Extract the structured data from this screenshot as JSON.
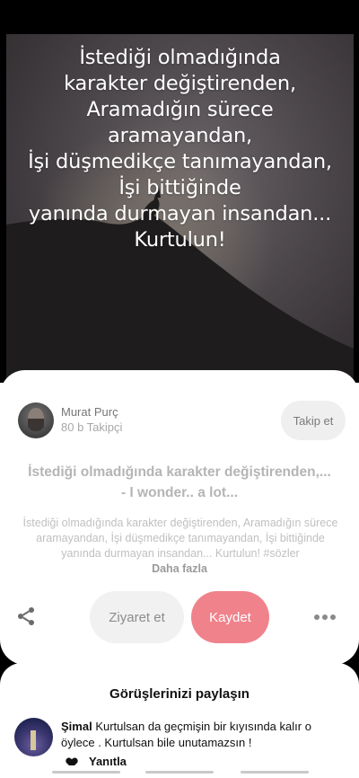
{
  "pin": {
    "quote_text": "İstediği olmadığında\nkarakter değiştirenden,\nAramadığın sürece\naramayandan,\nİşi düşmedikçe tanımayandan,\nİşi bittiğinde\nyanında durmayan insandan...\nKurtulun!"
  },
  "profile": {
    "name": "Murat Purç",
    "followers": "80 b Takipçi",
    "follow_label": "Takip et"
  },
  "details": {
    "title": "İstediği olmadığında karakter değiştirenden,...\n- I wonder.. a lot...",
    "description": "İstediği olmadığında karakter değiştirenden,  Aramadığın sürece aramayandan,  İşi düşmedikçe tanımayandan,  İşi bittiğinde yanında durmayan insandan...  Kurtulun!  #sözler",
    "more_label": "Daha fazla"
  },
  "actions": {
    "share_icon": "share-icon",
    "visit_label": "Ziyaret et",
    "save_label": "Kaydet",
    "more_icon": "more-horizontal-icon",
    "save_color": "#f0828c"
  },
  "comments": {
    "heading": "Görüşlerinizi paylaşın",
    "items": [
      {
        "author": "Şimal",
        "text": "Kurtulsan da geçmişin bir kıyısında kalır o öylece . Kurtulsan bile unutamazsın !",
        "reply_label": "Yanıtla"
      }
    ]
  }
}
